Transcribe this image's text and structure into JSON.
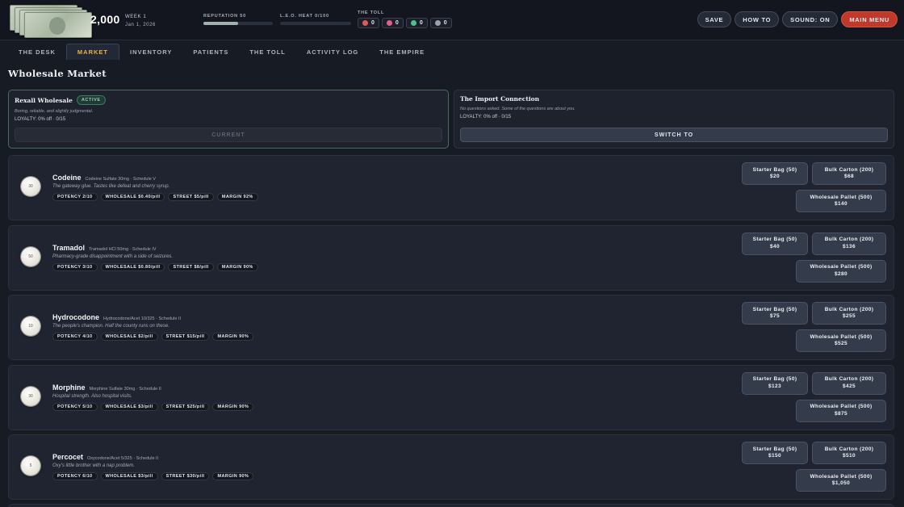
{
  "header": {
    "cash": "2,000",
    "week": "WEEK 1",
    "date": "Jan 1, 2026",
    "reputation_label": "REPUTATION 50",
    "reputation_value": 50,
    "heat_label": "L.E.O. HEAT 0/100",
    "heat_value": 0,
    "toll_label": "THE TOLL",
    "toll": [
      {
        "icon": "heart-icon",
        "value": "0",
        "color": "#e05b5b"
      },
      {
        "icon": "pill-bottle-icon",
        "value": "0",
        "color": "#e35f8a"
      },
      {
        "icon": "drop-icon",
        "value": "0",
        "color": "#49c38e"
      },
      {
        "icon": "grid-icon",
        "value": "0",
        "color": "#9aa1ad"
      }
    ],
    "buttons": {
      "save": "SAVE",
      "how_to": "HOW TO",
      "sound": "SOUND: ON",
      "main_menu": "MAIN MENU"
    }
  },
  "tabs": [
    "THE DESK",
    "MARKET",
    "INVENTORY",
    "PATIENTS",
    "THE TOLL",
    "ACTIVITY LOG",
    "THE EMPIRE"
  ],
  "active_tab": "MARKET",
  "section_title": "Wholesale Market",
  "suppliers": [
    {
      "name": "Rexall Wholesale",
      "badge": "ACTIVE",
      "desc": "Boring, reliable, and slightly judgmental.",
      "loyalty": "LOYALTY: 0% off · 0/15",
      "button": "CURRENT"
    },
    {
      "name": "The Import Connection",
      "badge": "",
      "desc": "No questions asked. Some of the questions are about you.",
      "loyalty": "LOYALTY: 0% off · 0/15",
      "button": "SWITCH TO"
    }
  ],
  "products": [
    {
      "pill": "30",
      "name": "Codeine",
      "sub": "Codeine Sulfate 30mg · Schedule V",
      "desc": "The gateway glue. Tastes like defeat and cherry syrup.",
      "tags": [
        "POTENCY 2/10",
        "WHOLESALE $0.40/pill",
        "STREET $5/pill",
        "MARGIN 92%"
      ],
      "starter": {
        "label": "Starter Bag (50)",
        "price": "$20"
      },
      "bulk": {
        "label": "Bulk Carton (200)",
        "price": "$68"
      },
      "pallet": {
        "label": "Wholesale Pallet (500)",
        "price": "$140"
      }
    },
    {
      "pill": "50",
      "name": "Tramadol",
      "sub": "Tramadol HCl 50mg · Schedule IV",
      "desc": "Pharmacy-grade disappointment with a side of seizures.",
      "tags": [
        "POTENCY 3/10",
        "WHOLESALE $0.80/pill",
        "STREET $8/pill",
        "MARGIN 90%"
      ],
      "starter": {
        "label": "Starter Bag (50)",
        "price": "$40"
      },
      "bulk": {
        "label": "Bulk Carton (200)",
        "price": "$136"
      },
      "pallet": {
        "label": "Wholesale Pallet (500)",
        "price": "$280"
      }
    },
    {
      "pill": "10",
      "name": "Hydrocodone",
      "sub": "Hydrocodone/Acet 10/325 · Schedule II",
      "desc": "The people's champion. Half the county runs on these.",
      "tags": [
        "POTENCY 4/10",
        "WHOLESALE $2/pill",
        "STREET $15/pill",
        "MARGIN 90%"
      ],
      "starter": {
        "label": "Starter Bag (50)",
        "price": "$75"
      },
      "bulk": {
        "label": "Bulk Carton (200)",
        "price": "$255"
      },
      "pallet": {
        "label": "Wholesale Pallet (500)",
        "price": "$525"
      }
    },
    {
      "pill": "30",
      "name": "Morphine",
      "sub": "Morphine Sulfate 30mg · Schedule II",
      "desc": "Hospital strength. Also hospital visits.",
      "tags": [
        "POTENCY 5/10",
        "WHOLESALE $3/pill",
        "STREET $25/pill",
        "MARGIN 90%"
      ],
      "starter": {
        "label": "Starter Bag (50)",
        "price": "$123"
      },
      "bulk": {
        "label": "Bulk Carton (200)",
        "price": "$425"
      },
      "pallet": {
        "label": "Wholesale Pallet (500)",
        "price": "$875"
      }
    },
    {
      "pill": "5",
      "name": "Percocet",
      "sub": "Oxycodone/Acet 5/325 · Schedule II",
      "desc": "Oxy's little brother with a nap problem.",
      "tags": [
        "POTENCY 6/10",
        "WHOLESALE $3/pill",
        "STREET $30/pill",
        "MARGIN 90%"
      ],
      "starter": {
        "label": "Starter Bag (50)",
        "price": "$150"
      },
      "bulk": {
        "label": "Bulk Carton (200)",
        "price": "$510"
      },
      "pallet": {
        "label": "Wholesale Pallet (500)",
        "price": "$1,050"
      }
    }
  ]
}
